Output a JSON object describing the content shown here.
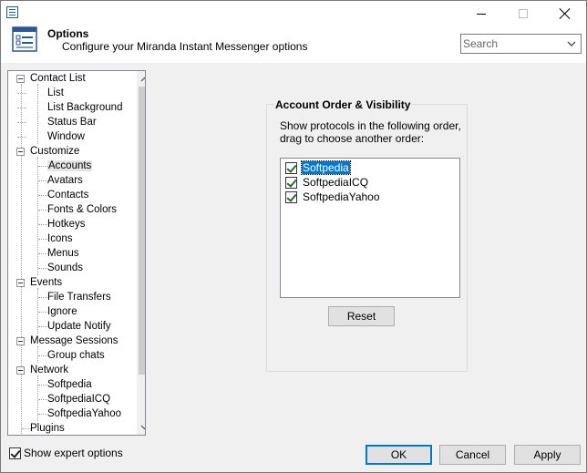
{
  "window": {
    "icon": "options-app-icon",
    "controls": {
      "minimize": "minimize-icon",
      "maximize": "maximize-icon",
      "close": "close-icon"
    }
  },
  "header": {
    "title": "Options",
    "subtitle": "Configure your Miranda Instant Messenger options",
    "icon": "options-panel-icon"
  },
  "search": {
    "placeholder": "Search",
    "value": ""
  },
  "tree": {
    "items": [
      {
        "label": "Contact List",
        "level": 0,
        "expanded": true
      },
      {
        "label": "List",
        "level": 1
      },
      {
        "label": "List Background",
        "level": 1
      },
      {
        "label": "Status Bar",
        "level": 1
      },
      {
        "label": "Window",
        "level": 1
      },
      {
        "label": "Customize",
        "level": 0,
        "expanded": true
      },
      {
        "label": "Accounts",
        "level": 1,
        "selected": true
      },
      {
        "label": "Avatars",
        "level": 1
      },
      {
        "label": "Contacts",
        "level": 1
      },
      {
        "label": "Fonts & Colors",
        "level": 1
      },
      {
        "label": "Hotkeys",
        "level": 1
      },
      {
        "label": "Icons",
        "level": 1
      },
      {
        "label": "Menus",
        "level": 1
      },
      {
        "label": "Sounds",
        "level": 1
      },
      {
        "label": "Events",
        "level": 0,
        "expanded": true
      },
      {
        "label": "File Transfers",
        "level": 1
      },
      {
        "label": "Ignore",
        "level": 1
      },
      {
        "label": "Update Notify",
        "level": 1
      },
      {
        "label": "Message Sessions",
        "level": 0,
        "expanded": true
      },
      {
        "label": "Group chats",
        "level": 1
      },
      {
        "label": "Network",
        "level": 0,
        "expanded": true
      },
      {
        "label": "Softpedia",
        "level": 1
      },
      {
        "label": "SoftpediaICQ",
        "level": 1
      },
      {
        "label": "SoftpediaYahoo",
        "level": 1
      },
      {
        "label": "Plugins",
        "level": 0
      }
    ]
  },
  "expert": {
    "label": "Show expert options",
    "checked": true
  },
  "panel": {
    "title": "Account Order & Visibility",
    "description": "Show protocols in the following order, drag to choose another order:",
    "accounts": [
      {
        "label": "Softpedia",
        "checked": true,
        "focused": true
      },
      {
        "label": "SoftpediaICQ",
        "checked": true
      },
      {
        "label": "SoftpediaYahoo",
        "checked": true
      }
    ],
    "reset_label": "Reset"
  },
  "buttons": {
    "ok": "OK",
    "cancel": "Cancel",
    "apply": "Apply"
  },
  "colors": {
    "accent": "#0078d7",
    "selection": "#e5e5e5",
    "background": "#f0f0f0"
  }
}
